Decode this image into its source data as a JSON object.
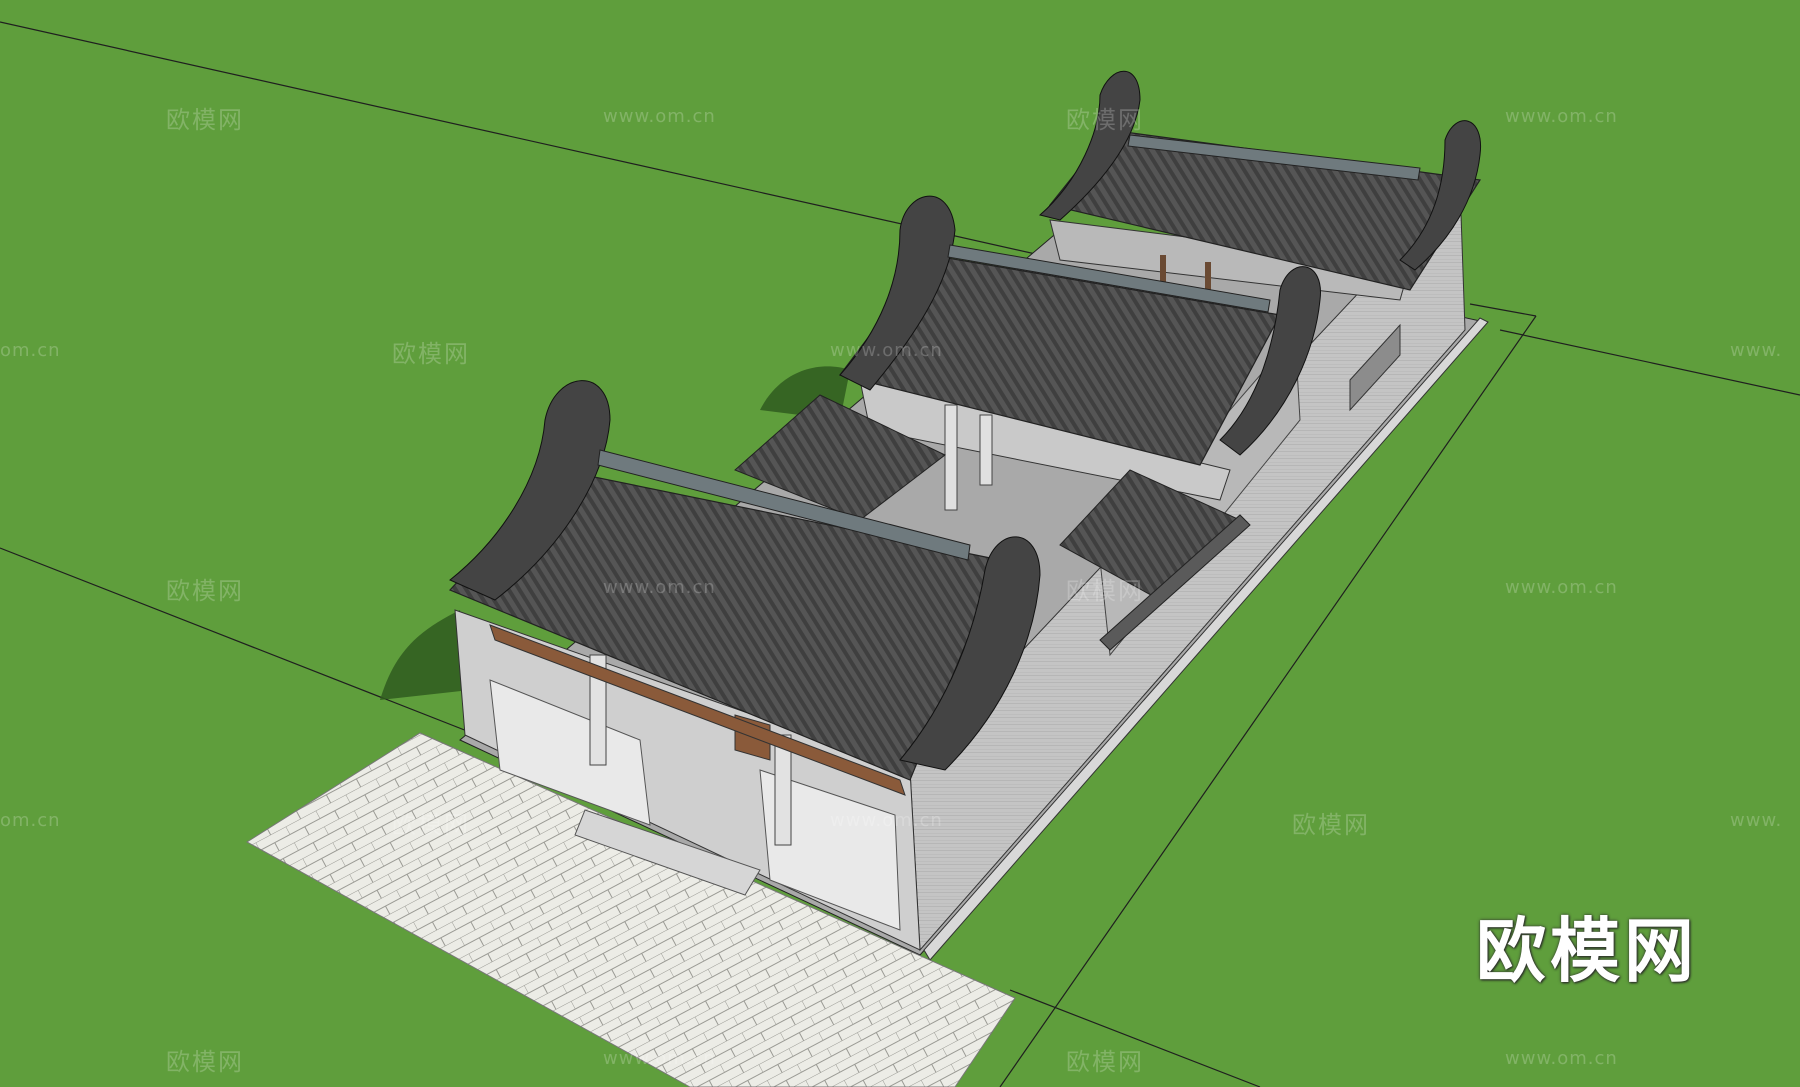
{
  "scene": {
    "subject": "3D model of a traditional Chinese ancestral hall with three halls, grey tiled roofs and curved wok-ear gable walls, on a green ground plane with a white paved forecourt",
    "colors": {
      "ground": "#5f9e3c",
      "roof": "#4a4a4a",
      "wall": "#bdbdbd",
      "paving": "#e6e6e0",
      "timber": "#8a5a3a"
    }
  },
  "watermarks": {
    "brand": "欧模网",
    "url": "www.om.cn",
    "partial_url": "om.cn",
    "partial_url_right": "www."
  },
  "logo": {
    "text": "欧模网"
  }
}
